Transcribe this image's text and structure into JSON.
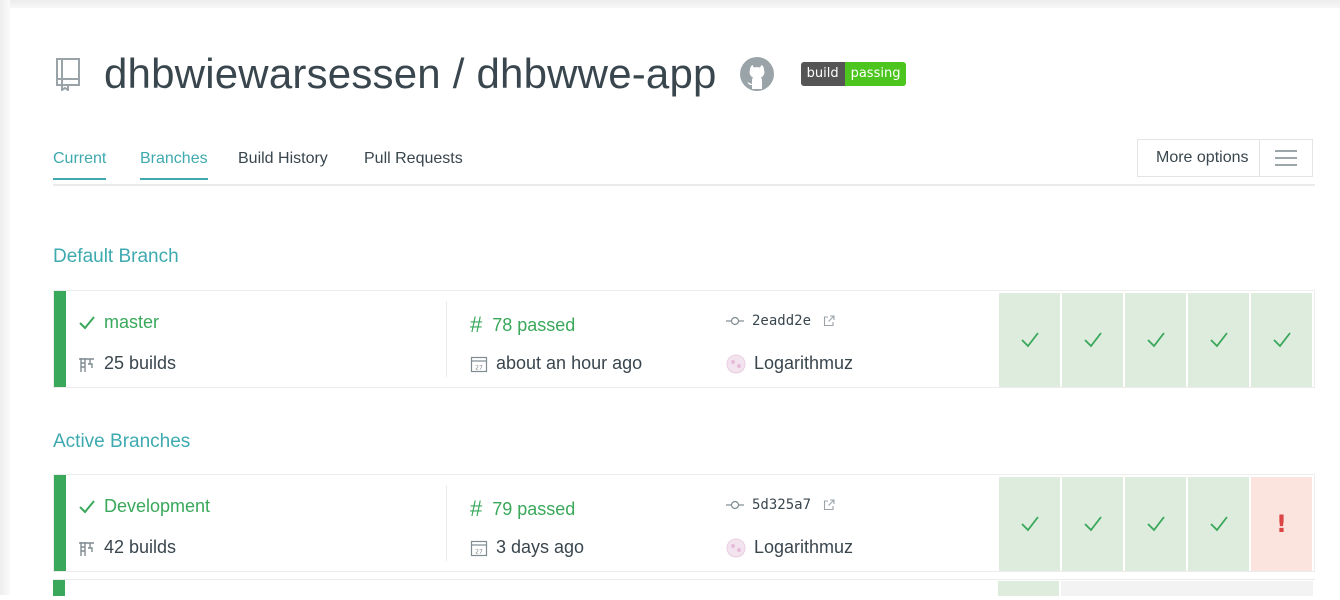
{
  "repo": {
    "title": "dhbwiewarsessen / dhbwwe-app",
    "badge_left": "build",
    "badge_right": "passing"
  },
  "tabs": [
    {
      "label": "Current",
      "active": true
    },
    {
      "label": "Branches",
      "active": true
    },
    {
      "label": "Build History",
      "active": false
    },
    {
      "label": "Pull Requests",
      "active": false
    }
  ],
  "more_options": {
    "label": "More options"
  },
  "sections": {
    "default_title": "Default Branch",
    "active_title": "Active Branches"
  },
  "branches": [
    {
      "name": "master",
      "builds": "25 builds",
      "build": "78 passed",
      "date": "about an hour ago",
      "commit": "2eadd2e",
      "author": "Logarithmuz",
      "history": [
        "passed",
        "passed",
        "passed",
        "passed",
        "passed"
      ]
    },
    {
      "name": "Development",
      "builds": "42 builds",
      "build": "79 passed",
      "date": "3 days ago",
      "commit": "5d325a7",
      "author": "Logarithmuz",
      "history": [
        "passed",
        "passed",
        "passed",
        "passed",
        "failed"
      ]
    }
  ],
  "colors": {
    "accent": "#3eaaaf",
    "passed": "#39a85b",
    "failed": "#db4545",
    "badge_pass": "#4cc61e"
  }
}
